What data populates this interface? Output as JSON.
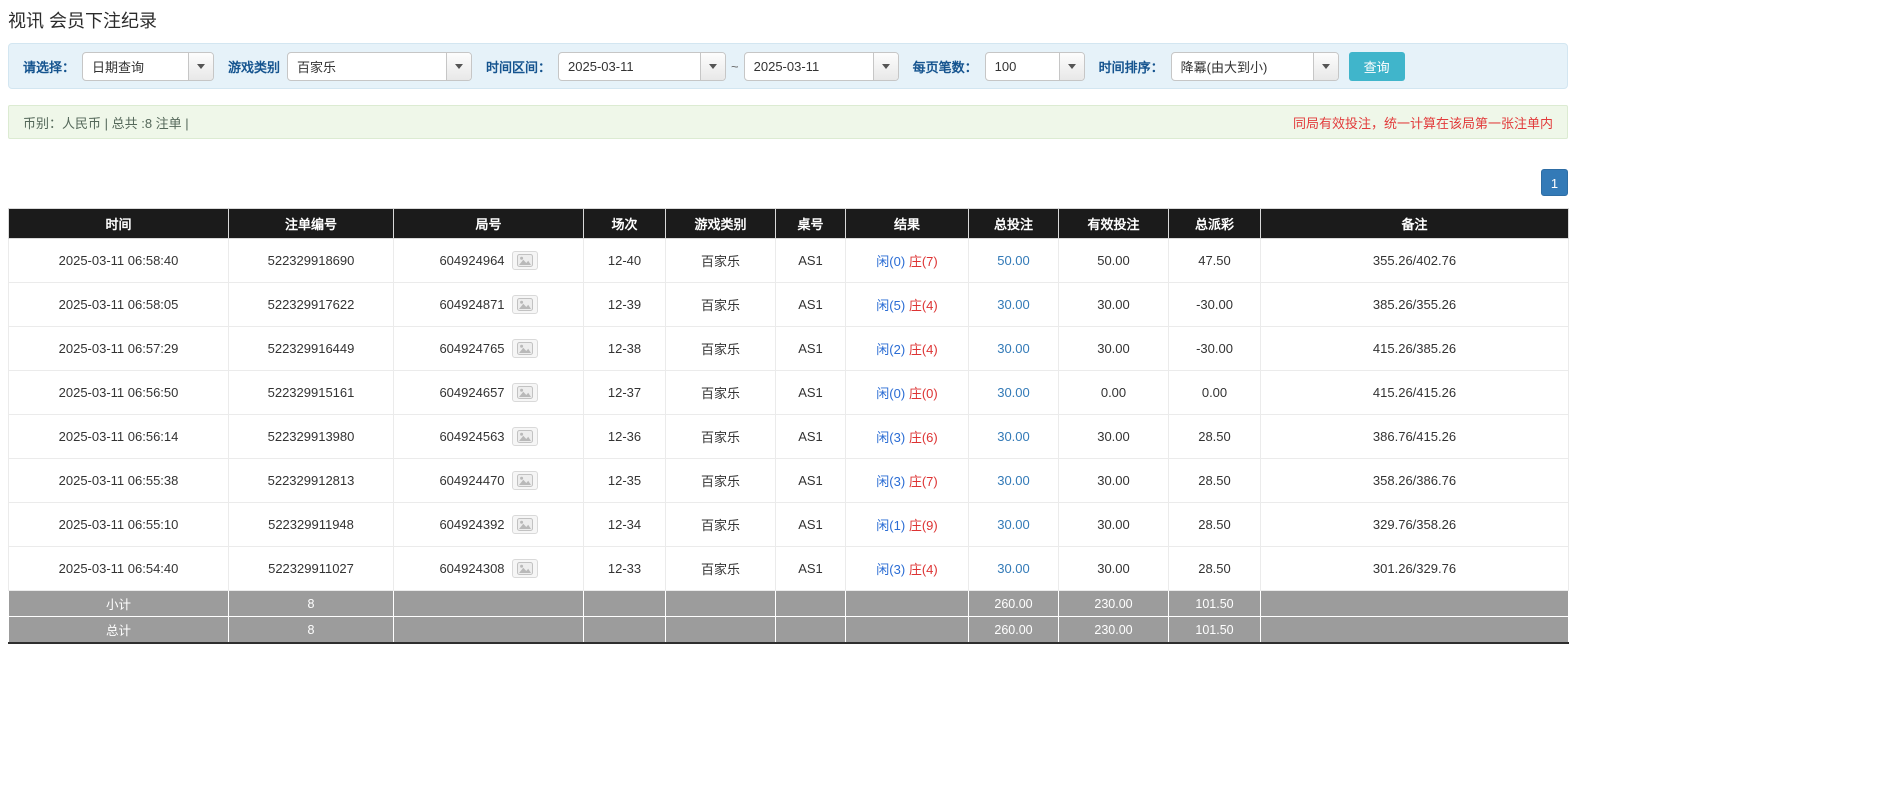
{
  "page": {
    "title": "视讯 会员下注纪录"
  },
  "filters": {
    "select_label": "请选择：",
    "select_value": "日期查询",
    "game_type_label": "游戏类别",
    "game_type_value": "百家乐",
    "time_range_label": "时间区间：",
    "date_from": "2025-03-11",
    "date_separator": "~",
    "date_to": "2025-03-11",
    "page_size_label": "每页笔数：",
    "page_size_value": "100",
    "sort_label": "时间排序：",
    "sort_value": "降冪(由大到小)",
    "search_button": "查询"
  },
  "summary": {
    "left": "币别：人民币 | 总共 :8 注单 |",
    "right": "同局有效投注，统一计算在该局第一张注单内"
  },
  "pagination": {
    "current": "1"
  },
  "table": {
    "headers": [
      "时间",
      "注单编号",
      "局号",
      "场次",
      "游戏类别",
      "桌号",
      "结果",
      "总投注",
      "有效投注",
      "总派彩",
      "备注"
    ],
    "rows": [
      {
        "time": "2025-03-11 06:58:40",
        "bet_id": "522329918690",
        "round_id": "604924964",
        "session": "12-40",
        "game_type": "百家乐",
        "table_no": "AS1",
        "result_player": "闲(0)",
        "result_banker": "庄(7)",
        "total_bet": "50.00",
        "valid_bet": "50.00",
        "payout": "47.50",
        "remark": "355.26/402.76"
      },
      {
        "time": "2025-03-11 06:58:05",
        "bet_id": "522329917622",
        "round_id": "604924871",
        "session": "12-39",
        "game_type": "百家乐",
        "table_no": "AS1",
        "result_player": "闲(5)",
        "result_banker": "庄(4)",
        "total_bet": "30.00",
        "valid_bet": "30.00",
        "payout": "-30.00",
        "remark": "385.26/355.26"
      },
      {
        "time": "2025-03-11 06:57:29",
        "bet_id": "522329916449",
        "round_id": "604924765",
        "session": "12-38",
        "game_type": "百家乐",
        "table_no": "AS1",
        "result_player": "闲(2)",
        "result_banker": "庄(4)",
        "total_bet": "30.00",
        "valid_bet": "30.00",
        "payout": "-30.00",
        "remark": "415.26/385.26"
      },
      {
        "time": "2025-03-11 06:56:50",
        "bet_id": "522329915161",
        "round_id": "604924657",
        "session": "12-37",
        "game_type": "百家乐",
        "table_no": "AS1",
        "result_player": "闲(0)",
        "result_banker": "庄(0)",
        "total_bet": "30.00",
        "valid_bet": "0.00",
        "payout": "0.00",
        "remark": "415.26/415.26"
      },
      {
        "time": "2025-03-11 06:56:14",
        "bet_id": "522329913980",
        "round_id": "604924563",
        "session": "12-36",
        "game_type": "百家乐",
        "table_no": "AS1",
        "result_player": "闲(3)",
        "result_banker": "庄(6)",
        "total_bet": "30.00",
        "valid_bet": "30.00",
        "payout": "28.50",
        "remark": "386.76/415.26"
      },
      {
        "time": "2025-03-11 06:55:38",
        "bet_id": "522329912813",
        "round_id": "604924470",
        "session": "12-35",
        "game_type": "百家乐",
        "table_no": "AS1",
        "result_player": "闲(3)",
        "result_banker": "庄(7)",
        "total_bet": "30.00",
        "valid_bet": "30.00",
        "payout": "28.50",
        "remark": "358.26/386.76"
      },
      {
        "time": "2025-03-11 06:55:10",
        "bet_id": "522329911948",
        "round_id": "604924392",
        "session": "12-34",
        "game_type": "百家乐",
        "table_no": "AS1",
        "result_player": "闲(1)",
        "result_banker": "庄(9)",
        "total_bet": "30.00",
        "valid_bet": "30.00",
        "payout": "28.50",
        "remark": "329.76/358.26"
      },
      {
        "time": "2025-03-11 06:54:40",
        "bet_id": "522329911027",
        "round_id": "604924308",
        "session": "12-33",
        "game_type": "百家乐",
        "table_no": "AS1",
        "result_player": "闲(3)",
        "result_banker": "庄(4)",
        "total_bet": "30.00",
        "valid_bet": "30.00",
        "payout": "28.50",
        "remark": "301.26/329.76"
      }
    ],
    "subtotal": {
      "label": "小计",
      "count": "8",
      "total_bet": "260.00",
      "valid_bet": "230.00",
      "payout": "101.50"
    },
    "total": {
      "label": "总计",
      "count": "8",
      "total_bet": "260.00",
      "valid_bet": "230.00",
      "payout": "101.50"
    }
  },
  "colors": {
    "accent_blue": "#337ab7",
    "player_blue": "#2a6cd4",
    "banker_red": "#dd3333",
    "negative_red": "#e03b3b",
    "search_teal": "#40b5cb",
    "header_black": "#1b1b1b",
    "footer_gray": "#9c9c9c",
    "filter_bar_blue": "#e6f2f9",
    "summary_bar_green": "#eff7e9"
  }
}
